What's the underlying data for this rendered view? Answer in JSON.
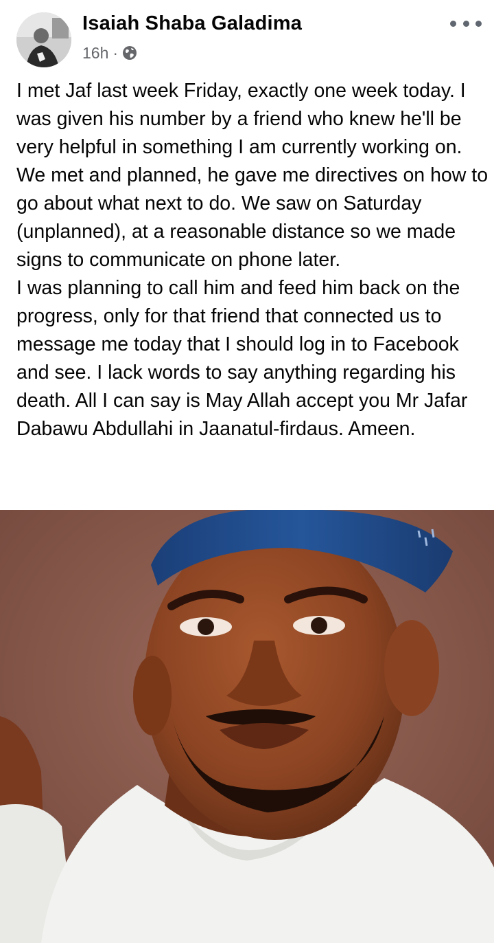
{
  "post": {
    "author": {
      "name": "Isaiah Shaba Galadima"
    },
    "timestamp": "16h",
    "separator": "·",
    "privacy_icon": "globe-icon",
    "more_icon": "more-options-icon",
    "text_paragraph_1": "I met Jaf last week Friday, exactly one week today. I was given his number by a friend who knew he'll be very helpful in something I am currently working on. We met and planned, he gave me directives on how to go about what next to do. We saw on Saturday (unplanned), at a reasonable distance so we made signs to communicate on phone later.",
    "text_paragraph_2": "I was planning to call him and feed him back on the progress, only for that friend that connected us to message me today that I should log in to Facebook and see. I lack words to say anything regarding his death. All I can say is May Allah accept you Mr Jafar Dabawu Abdullahi in Jaanatul-firdaus. Ameen."
  },
  "colors": {
    "text": "#050505",
    "secondary_text": "#65676b",
    "photo_background": "#8a5a4e",
    "cap_blue": "#1f4f8f",
    "garment_white": "#f2f2f0"
  }
}
